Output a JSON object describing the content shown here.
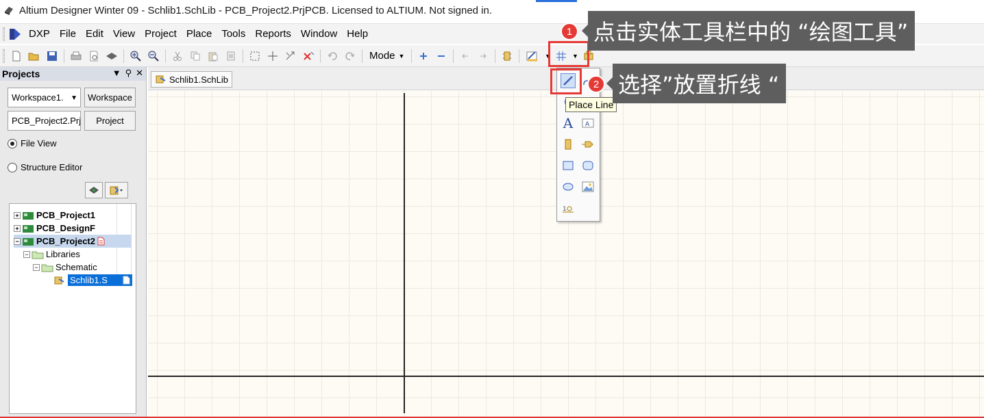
{
  "window": {
    "title": "Altium Designer Winter 09 - Schlib1.SchLib - PCB_Project2.PrjPCB. Licensed to ALTIUM. Not signed in."
  },
  "menu": {
    "items": [
      "DXP",
      "File",
      "Edit",
      "View",
      "Project",
      "Place",
      "Tools",
      "Reports",
      "Window",
      "Help"
    ]
  },
  "toolbar": {
    "mode_label": "Mode"
  },
  "projects_panel": {
    "title": "Projects",
    "workspace_combo": "Workspace1.",
    "workspace_button": "Workspace",
    "project_combo": "PCB_Project2.Prj",
    "project_button": "Project",
    "radio_file_view": "File View",
    "radio_structure_editor": "Structure Editor",
    "tree": [
      {
        "label": "PCB_Project1"
      },
      {
        "label": "PCB_DesignF"
      },
      {
        "label": "PCB_Project2"
      },
      {
        "label": "Libraries"
      },
      {
        "label": "Schematic"
      },
      {
        "label": "Schlib1.S"
      }
    ]
  },
  "document": {
    "tab_label": "Schlib1.SchLib"
  },
  "drawing_tools": {
    "tooltip": "Place Line"
  },
  "annotations": {
    "step1_number": "1",
    "step1_text": "点击实体工具栏中的 “绘图工具”",
    "step2_number": "2",
    "step2_text": "选择”放置折线 “"
  },
  "colors": {
    "highlight": "#e53935",
    "callout_bg": "#5e5e5e",
    "selection": "#0a6fd8"
  }
}
